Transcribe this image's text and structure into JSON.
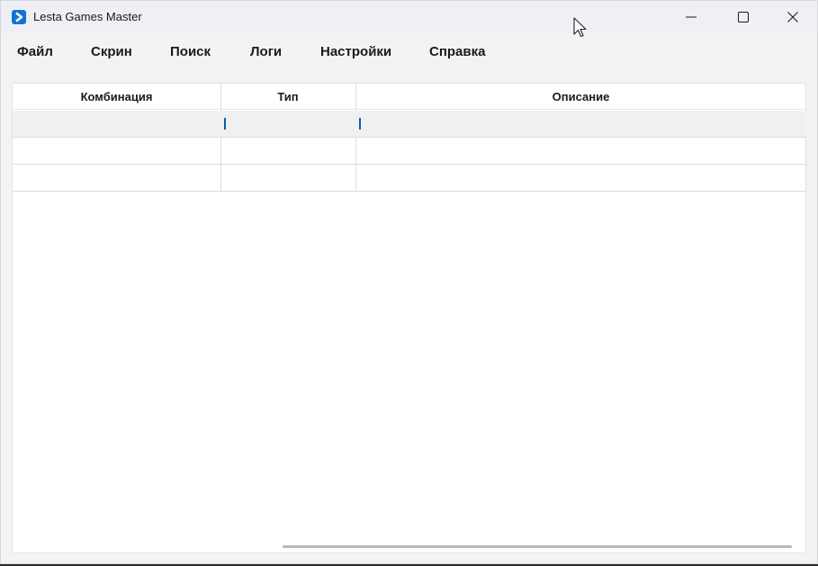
{
  "window": {
    "title": "Lesta Games Master",
    "app_icon": "app-logo-icon",
    "controls": [
      "minimize-icon",
      "maximize-icon",
      "close-icon"
    ]
  },
  "menu": {
    "items": [
      "Файл",
      "Скрин",
      "Поиск",
      "Логи",
      "Настройки",
      "Справка"
    ]
  },
  "table": {
    "columns": [
      "Комбинация",
      "Тип",
      "Описание"
    ],
    "rows": [
      [
        "",
        "",
        ""
      ],
      [
        "",
        "",
        ""
      ],
      [
        "",
        "",
        ""
      ]
    ]
  },
  "colors": {
    "accent": "#1573d6",
    "caret": "#0a5fb4"
  }
}
